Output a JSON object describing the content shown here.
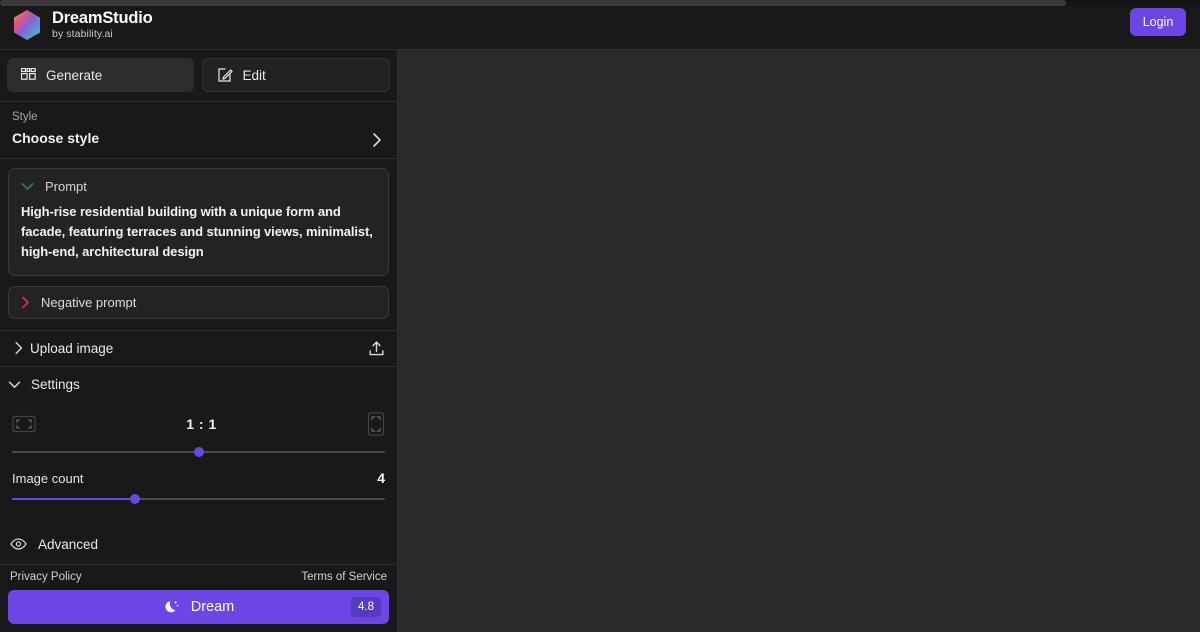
{
  "app": {
    "brand_name": "DreamStudio",
    "brand_subtitle": "by stability.ai",
    "logo_icon": "hexagon-gradient-logo"
  },
  "header": {
    "login_label": "Login"
  },
  "modes": [
    {
      "label": "Generate",
      "icon": "grid-squares-icon",
      "active": true
    },
    {
      "label": "Edit",
      "icon": "pencil-square-icon",
      "active": false
    }
  ],
  "style": {
    "label": "Style",
    "value": "Choose style",
    "chevron_icon": "chevron-right-icon"
  },
  "prompt": {
    "label": "Prompt",
    "chevron_icon": "chevron-down-icon",
    "chevron_color": "#1f7a52",
    "text": "High-rise residential building with a unique form and facade, featuring terraces and stunning views, minimalist, high-end, architectural design"
  },
  "negative_prompt": {
    "label": "Negative prompt",
    "chevron_icon": "chevron-right-icon",
    "chevron_color": "#b4343f"
  },
  "upload": {
    "label": "Upload image",
    "chevron_icon": "chevron-right-icon",
    "action_icon": "upload-arrow-icon"
  },
  "settings": {
    "label": "Settings",
    "chevron_icon": "chevron-down-icon",
    "aspect_ratio": {
      "value": "1 : 1",
      "landscape_icon": "landscape-frame-icon",
      "portrait_icon": "portrait-frame-icon",
      "slider_percent": 50
    },
    "image_count": {
      "label": "Image count",
      "value": "4",
      "slider_percent": 33
    },
    "advanced": {
      "label": "Advanced",
      "icon": "eye-icon"
    }
  },
  "footer": {
    "privacy_label": "Privacy Policy",
    "terms_label": "Terms of Service",
    "dream_label": "Dream",
    "dream_icon": "crescent-moon-stars-icon",
    "dream_cost": "4.8"
  },
  "theme": {
    "accent": "#6b46e5",
    "sidebar_bg": "#19191a",
    "canvas_bg": "#2a2a2c"
  }
}
